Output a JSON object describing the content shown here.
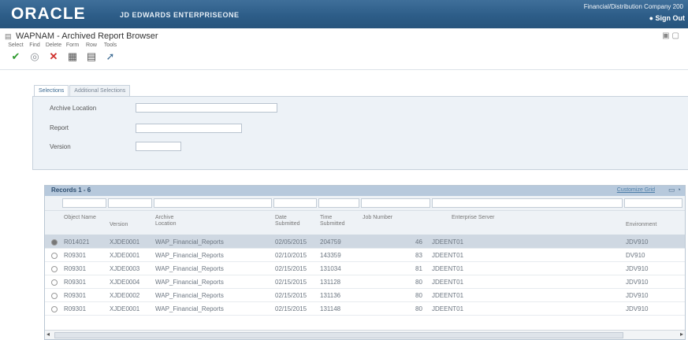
{
  "banner": {
    "logo": "ORACLE",
    "product": "JD EDWARDS ENTERPRISEONE",
    "company": "Financial/Distribution Company 200",
    "signout": "Sign Out"
  },
  "window": {
    "title": "WAPNAM - Archived Report Browser"
  },
  "toolbar": {
    "select": "Select",
    "find": "Find",
    "delete": "Delete",
    "form": "Form",
    "row": "Row",
    "tools": "Tools"
  },
  "tabs": [
    "Selections",
    "Additional Selections"
  ],
  "form": {
    "archive_location_label": "Archive Location",
    "archive_location_value": "",
    "report_label": "Report",
    "report_value": "",
    "version_label": "Version",
    "version_value": ""
  },
  "grid": {
    "title": "Records 1 - 6",
    "customize": "Customize Grid",
    "columns": [
      "Object Name",
      "Version",
      "Archive Location",
      "Date Submitted",
      "Time Submitted",
      "Job Number",
      "Enterprise Server",
      "Environment"
    ],
    "rows": [
      {
        "object": "R014021",
        "version": "XJDE0001",
        "location": "WAP_Financial_Reports",
        "date": "02/05/2015",
        "time": "204759",
        "job": "46",
        "server": "JDEENT01",
        "env": "JDV910",
        "selected": true
      },
      {
        "object": "R09301",
        "version": "XJDE0001",
        "location": "WAP_Financial_Reports",
        "date": "02/10/2015",
        "time": "143359",
        "job": "83",
        "server": "JDEENT01",
        "env": "DV910",
        "selected": false
      },
      {
        "object": "R09301",
        "version": "XJDE0003",
        "location": "WAP_Financial_Reports",
        "date": "02/15/2015",
        "time": "131034",
        "job": "81",
        "server": "JDEENT01",
        "env": "JDV910",
        "selected": false
      },
      {
        "object": "R09301",
        "version": "XJDE0004",
        "location": "WAP_Financial_Reports",
        "date": "02/15/2015",
        "time": "131128",
        "job": "80",
        "server": "JDEENT01",
        "env": "JDV910",
        "selected": false
      },
      {
        "object": "R09301",
        "version": "XJDE0002",
        "location": "WAP_Financial_Reports",
        "date": "02/15/2015",
        "time": "131136",
        "job": "80",
        "server": "JDEENT01",
        "env": "JDV910",
        "selected": false
      },
      {
        "object": "R09301",
        "version": "XJDE0001",
        "location": "WAP_Financial_Reports",
        "date": "02/15/2015",
        "time": "131148",
        "job": "80",
        "server": "JDEENT01",
        "env": "JDV910",
        "selected": false
      }
    ]
  },
  "colors": {
    "banner": "#2d5d88",
    "grid_header": "#b7c9dc",
    "selected_row": "#cfd8e2",
    "ok_green": "#2e9a2e",
    "delete_red": "#d0312d"
  }
}
